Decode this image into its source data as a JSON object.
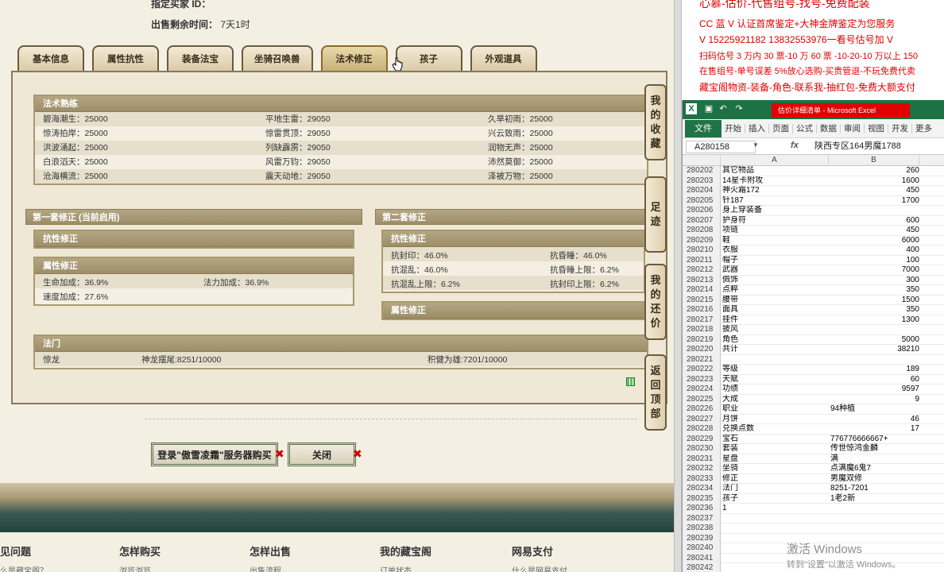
{
  "header": {
    "seller_id_label": "指定买家 ID：",
    "time_left_label": "出售剩余时间：",
    "time_left_value": "7天1时"
  },
  "tabs": [
    "基本信息",
    "属性抗性",
    "装备法宝",
    "坐骑召唤兽",
    "法术修正",
    "孩子",
    "外观道具"
  ],
  "active_tab": "法术修正",
  "spell_mastery": {
    "title": "法术熟练",
    "rows": [
      [
        "碧海潮生：25000",
        "平地生雷：29050",
        "久旱初雨：25000"
      ],
      [
        "惊涛拍岸：25000",
        "惊雷贯顶：29050",
        "兴云致雨：25000"
      ],
      [
        "洪波涌起：25000",
        "列缺霹雳：29050",
        "润物无声：25000"
      ],
      [
        "白浪滔天：25000",
        "风雷万钧：29050",
        "沛然莫御：25000"
      ],
      [
        "沧海横流：25000",
        "震天动地：29050",
        "泽被万物：25000"
      ]
    ]
  },
  "set1": {
    "title": "第一套修正 (当前启用)",
    "resist_title": "抗性修正",
    "attr_title": "属性修正",
    "attr_rows": [
      [
        "生命加成：36.9%",
        "法力加成：36.9%"
      ],
      [
        "速度加成：27.6%",
        ""
      ]
    ]
  },
  "set2": {
    "title": "第二套修正",
    "resist_title": "抗性修正",
    "resist_rows": [
      [
        "抗封印：46.0%",
        "抗昏睡：46.0%"
      ],
      [
        "抗混乱：46.0%",
        "抗昏睡上限：6.2%"
      ],
      [
        "抗混乱上限：6.2%",
        "抗封印上限：6.2%"
      ]
    ],
    "attr_title": "属性修正"
  },
  "fa_men": {
    "title": "法门",
    "name": "惊龙",
    "item1": "神龙摆尾:8251/10000",
    "item2": "积健为雄:7201/10000"
  },
  "side_buttons": [
    "我的收藏",
    "足迹",
    "我的还价",
    "返回顶部"
  ],
  "actions": {
    "buy": "登录\"傲雪凌霜\"服务器购买",
    "close": "关闭"
  },
  "footer": [
    {
      "title": "见问题",
      "sub": "么是藏宝阁？"
    },
    {
      "title": "怎样购买",
      "sub": "浏览浏览"
    },
    {
      "title": "怎样出售",
      "sub": "出售流程"
    },
    {
      "title": "我的藏宝阁",
      "sub": "订单状态"
    },
    {
      "title": "网易支付",
      "sub": "什么是网易支付"
    }
  ],
  "ad_notes": [
    "心慕-估价-代售组号-找号-免费配装",
    "CC 蓝 V 认证首席鉴定+大神金牌鉴定为您服务",
    "V 15225921182      13832553976一看号估号加 V",
    "扫码估号 3 万内 30 票-10 万 60 票 -10-20-10 万以上 150",
    "在售组号-单号误差 5%放心选购-买贵管退-不玩免费代卖",
    "藏宝阁物资-装备-角色-联系我-抽红包-免费大额支付"
  ],
  "excel": {
    "title": "估价详细清单 - Microsoft Excel",
    "ribbon": [
      "开始",
      "插入",
      "页面",
      "公式",
      "数据",
      "审阅",
      "视图",
      "开发",
      "更多"
    ],
    "file_tab": "文件",
    "name_box": "A280158",
    "formula": "陕西专区164男魔1788",
    "col_a": "A",
    "col_b": "B",
    "rows": [
      [
        "280202",
        "其它物品",
        "260"
      ],
      [
        "280203",
        "14星卡附攻",
        "1600"
      ],
      [
        "280204",
        "神火霜172",
        "450"
      ],
      [
        "280205",
        "针187",
        "1700"
      ],
      [
        "280206",
        "身上穿装备",
        ""
      ],
      [
        "280207",
        "护身符",
        "600"
      ],
      [
        "280208",
        "项链",
        "450"
      ],
      [
        "280209",
        "鞋",
        "6000"
      ],
      [
        "280210",
        "衣服",
        "400"
      ],
      [
        "280211",
        "帽子",
        "100"
      ],
      [
        "280212",
        "武器",
        "7000"
      ],
      [
        "280213",
        "佩饰",
        "300"
      ],
      [
        "280214",
        "点粹",
        "350"
      ],
      [
        "280215",
        "腰带",
        "1500"
      ],
      [
        "280216",
        "面具",
        "350"
      ],
      [
        "280217",
        "挂件",
        "1300"
      ],
      [
        "280218",
        "披风",
        ""
      ],
      [
        "280219",
        "角色",
        "5000"
      ],
      [
        "280220",
        "共计",
        "38210"
      ],
      [
        "280221",
        "",
        ""
      ],
      [
        "280222",
        "等级",
        "189"
      ],
      [
        "280223",
        "天赋",
        "60"
      ],
      [
        "280224",
        "功绩",
        "9597"
      ],
      [
        "280225",
        "大成",
        "9"
      ],
      [
        "280226",
        "职业",
        "94种植"
      ],
      [
        "280227",
        "月饼",
        "46"
      ],
      [
        "280228",
        "兑换点数",
        "17"
      ],
      [
        "280229",
        "宝石",
        "776776666667+"
      ],
      [
        "280230",
        "套装",
        "传世惊鸿金麟"
      ],
      [
        "280231",
        "星盘",
        "满"
      ],
      [
        "280232",
        "坐骑",
        "点满魔6鬼7"
      ],
      [
        "280233",
        "修正",
        "男魔双修"
      ],
      [
        "280234",
        "法门",
        "8251-7201"
      ],
      [
        "280235",
        "孩子",
        "1老2新"
      ],
      [
        "280236",
        "1",
        ""
      ],
      [
        "280237",
        "",
        ""
      ],
      [
        "280238",
        "",
        ""
      ],
      [
        "280239",
        "",
        ""
      ],
      [
        "280240",
        "",
        ""
      ],
      [
        "280241",
        "",
        ""
      ],
      [
        "280242",
        "",
        ""
      ]
    ]
  },
  "watermark": {
    "line1": "激活 Windows",
    "line2": "转到\"设置\"以激活 Windows。"
  }
}
